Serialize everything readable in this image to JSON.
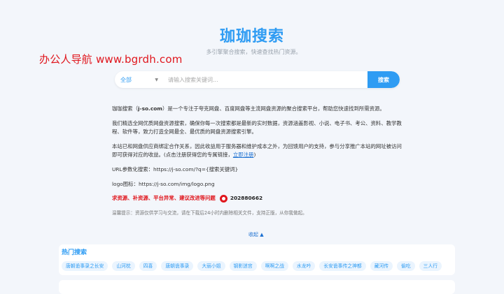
{
  "watermark": "办公人导航  www.bgrdh.com",
  "header": {
    "title": "珈珈搜索",
    "subtitle": "多引擎聚合搜索，快速查找热门资源。"
  },
  "search": {
    "scope": "全部",
    "placeholder": "请输入搜索关键词...",
    "button": "搜索"
  },
  "intro": {
    "p1_before": "珈珈搜索（",
    "p1_domain": "j-so.com",
    "p1_after": "）是一个专注于夸克网盘、百度网盘等主流网盘资源的聚合搜索平台，帮助您快速找到所需资源。",
    "p2": "我们精选全网优质网盘资源搜索，确保你每一次搜索都是最新的实时数据，资源涵盖影视、小说、电子书、考公、资料、教学教程、软件等，致力打造全网最全、最优质的网盘资源搜索引擎。",
    "p3_text": "本站已和网盘供应商绑定合作关系，因此收益用于服务器和维护成本之外，为回馈用户的支持，参与分享推广本站的网址被访问即可获得对应的收益。(点击注册获得您的专属链接，",
    "p3_link": "立即注册",
    "p3_end": ")",
    "url_param": "URL参数化搜索：https://j-so.com/?q={搜索关键词}",
    "logo": "logo图标：https://j-so.com/img/logo.png",
    "red_line": "求资源、补资源、平台异常、建议改进等问题",
    "qq_number": "202880662",
    "notice": "温馨提示：资源仅供学习与交流，请在下载后24小时内删除相关文件，支持正版，从你我做起。"
  },
  "collapse": "收起 ▲",
  "hot": {
    "title": "热门搜索",
    "tags": [
      "唐朝诡事录之长安",
      "山河枕",
      "四喜",
      "唐朝诡事录",
      "大丽小姐",
      "钢影迷宫",
      "啊啊之战",
      "水龙吟",
      "长安诡事传之神都",
      "藏河传",
      "偷吃",
      "三人行"
    ]
  },
  "icons": {
    "scope_chevron": "chevron-down-icon",
    "qq": "qq-icon"
  },
  "colors": {
    "accent": "#2f9cf3",
    "red": "#e0161d",
    "background": "#f3f6fb"
  }
}
